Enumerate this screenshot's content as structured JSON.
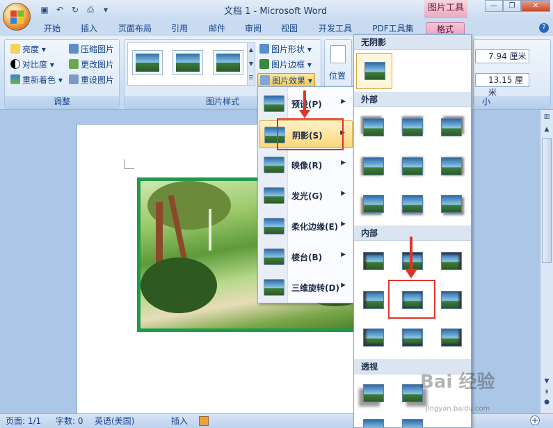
{
  "window": {
    "title": "文档 1 - Microsoft Word",
    "context_tab_title": "图片工具"
  },
  "tabs": [
    "开始",
    "插入",
    "页面布局",
    "引用",
    "邮件",
    "审阅",
    "视图",
    "开发工具",
    "PDF工具集",
    "格式"
  ],
  "ribbon": {
    "adjust": {
      "label": "调整",
      "buttons": [
        "亮度",
        "对比度",
        "重新着色",
        "压缩图片",
        "更改图片",
        "重设图片"
      ]
    },
    "picture_styles": {
      "label": "图片样式",
      "buttons": [
        "图片形状",
        "图片边框",
        "图片效果"
      ]
    },
    "arrange": {
      "position_label": "位置"
    },
    "size": {
      "height": "7.94 厘米",
      "width": "13.15 厘米",
      "label_partial": "小"
    }
  },
  "effects_menu": {
    "items": [
      "预设(P)",
      "阴影(S)",
      "映像(R)",
      "发光(G)",
      "柔化边缘(E)",
      "棱台(B)",
      "三维旋转(D)"
    ]
  },
  "shadow_gallery": {
    "sections": [
      "无阴影",
      "外部",
      "内部",
      "透视"
    ]
  },
  "status": {
    "page": "页面: 1/1",
    "words": "字数: 0",
    "language": "英语(美国)",
    "mode": "插入"
  },
  "watermark": {
    "brand": "Bai 经验",
    "url": "jingyan.baidu.com"
  },
  "colors": {
    "highlight": "#f9c855",
    "annotation": "#e0332a",
    "picture_border": "#1f9a4a"
  }
}
